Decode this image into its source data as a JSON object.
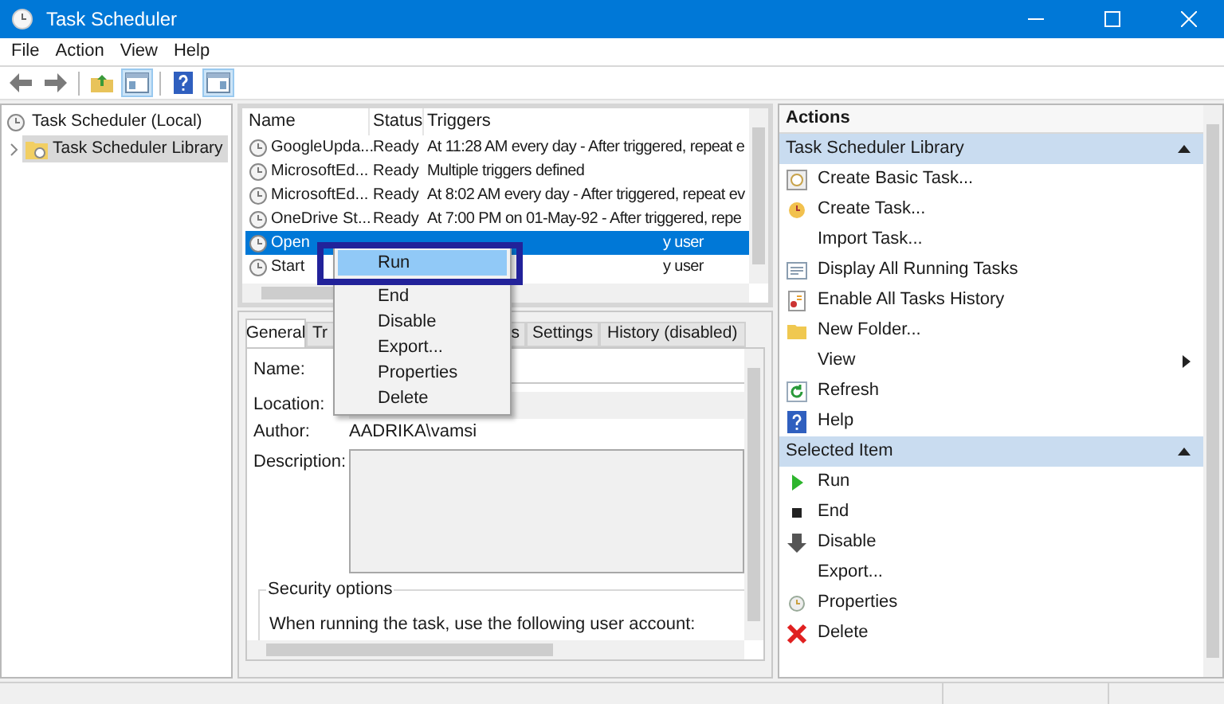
{
  "window": {
    "title": "Task Scheduler"
  },
  "menu_bar": [
    "File",
    "Action",
    "View",
    "Help"
  ],
  "toolbar": [
    {
      "kind": "back",
      "pressed": false
    },
    {
      "kind": "forward",
      "pressed": false
    },
    {
      "kind": "folder-up",
      "pressed": false
    },
    {
      "kind": "tree-pane",
      "pressed": true
    },
    {
      "kind": "help",
      "pressed": false
    },
    {
      "kind": "action-pane",
      "pressed": true
    }
  ],
  "tree": [
    {
      "label": "Task Scheduler (Local)",
      "selected": false,
      "children": [
        {
          "label": "Task Scheduler Library",
          "selected": true,
          "expanded": false
        }
      ]
    }
  ],
  "task_list": {
    "columns": [
      "Name",
      "Status",
      "Triggers"
    ],
    "rows": [
      {
        "name": "GoogleUpda...",
        "status": "Ready",
        "trigger": "At 11:28 AM every day - After triggered, repeat e",
        "selected": false
      },
      {
        "name": "MicrosoftEd...",
        "status": "Ready",
        "trigger": "Multiple triggers defined",
        "selected": false
      },
      {
        "name": "MicrosoftEd...",
        "status": "Ready",
        "trigger": "At 8:02 AM every day - After triggered, repeat ev",
        "selected": false
      },
      {
        "name": "OneDrive St...",
        "status": "Ready",
        "trigger": "At 7:00 PM on 01-May-92 - After triggered, repe",
        "selected": false
      },
      {
        "name": "Open",
        "trigger": "y user",
        "selected": true
      },
      {
        "name": "Start",
        "trigger": "y user",
        "selected": false
      }
    ]
  },
  "context_menu": [
    {
      "label": "Run",
      "highlighted": true
    },
    {
      "label": "End",
      "highlighted": false
    },
    {
      "label": "Disable",
      "highlighted": false
    },
    {
      "label": "Export...",
      "highlighted": false
    },
    {
      "label": "Properties",
      "highlighted": false
    },
    {
      "label": "Delete",
      "highlighted": false
    }
  ],
  "details": {
    "tabs": [
      {
        "label": "General",
        "selected": true
      },
      {
        "label": "Tr",
        "selected": false
      },
      {
        "label": "s",
        "selected": false
      },
      {
        "label": "Settings",
        "selected": false
      },
      {
        "label": "History (disabled)",
        "selected": false
      }
    ],
    "fields": [
      {
        "label": "Name:",
        "kind": "input"
      },
      {
        "label": "Location:",
        "kind": "readonly"
      },
      {
        "label": "Author:",
        "kind": "text",
        "value": "AADRIKA\\vamsi"
      },
      {
        "label": "Description:",
        "kind": "textarea"
      }
    ],
    "security_options": {
      "title": "Security options",
      "text": "When running the task, use the following user account:"
    }
  },
  "actions": {
    "title": "Actions",
    "sections": [
      {
        "title": "Task Scheduler Library",
        "items": [
          {
            "label": "Create Basic Task...",
            "kind": "basic-task"
          },
          {
            "label": "Create Task...",
            "kind": "task"
          },
          {
            "label": "Import Task...",
            "kind": "none"
          },
          {
            "label": "Display All Running Tasks",
            "kind": "running"
          },
          {
            "label": "Enable All Tasks History",
            "kind": "history"
          },
          {
            "label": "New Folder...",
            "kind": "folder"
          },
          {
            "label": "View",
            "kind": "submenu"
          },
          {
            "label": "Refresh",
            "kind": "refresh"
          },
          {
            "label": "Help",
            "kind": "help"
          }
        ]
      },
      {
        "title": "Selected Item",
        "items": [
          {
            "label": "Run",
            "kind": "run"
          },
          {
            "label": "End",
            "kind": "end"
          },
          {
            "label": "Disable",
            "kind": "disable"
          },
          {
            "label": "Export...",
            "kind": "none"
          },
          {
            "label": "Properties",
            "kind": "properties"
          },
          {
            "label": "Delete",
            "kind": "delete"
          }
        ]
      }
    ]
  }
}
